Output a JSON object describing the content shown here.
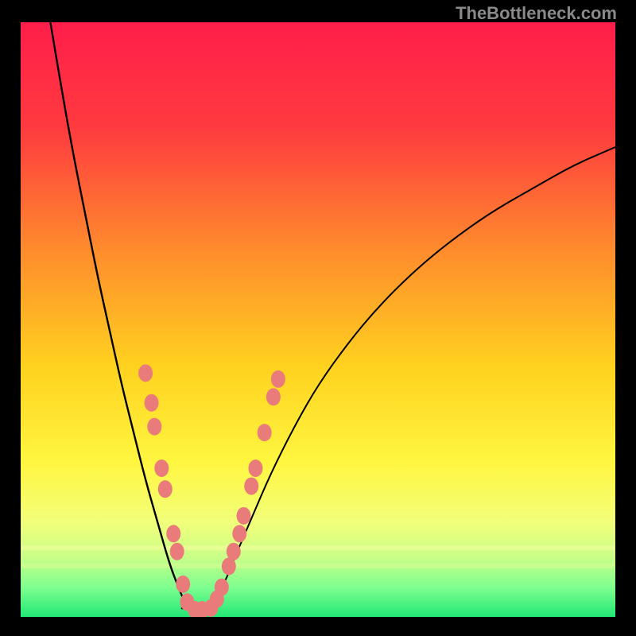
{
  "watermark": "TheBottleneck.com",
  "chart_data": {
    "type": "line",
    "title": "",
    "xlabel": "",
    "ylabel": "",
    "xlim": [
      0,
      100
    ],
    "ylim": [
      0,
      100
    ],
    "series": [
      {
        "name": "left-curve",
        "x": [
          5,
          7,
          9,
          11,
          13,
          15,
          17,
          19,
          21,
          23,
          25,
          26.5,
          28
        ],
        "y": [
          100,
          88,
          77,
          67,
          57,
          48,
          39,
          31,
          23,
          16,
          9,
          5,
          1.5
        ]
      },
      {
        "name": "right-curve",
        "x": [
          32,
          34,
          36,
          39,
          42,
          46,
          50,
          55,
          60,
          66,
          72,
          79,
          86,
          93,
          100
        ],
        "y": [
          1.5,
          5,
          10,
          17,
          24,
          32,
          39,
          46,
          52,
          58,
          63,
          68,
          72,
          76,
          79
        ]
      },
      {
        "name": "valley-floor",
        "x": [
          27,
          28.5,
          30,
          31.5,
          33
        ],
        "y": [
          1.5,
          1.2,
          1.2,
          1.2,
          1.5
        ]
      }
    ],
    "markers": {
      "name": "salmon-dots",
      "points": [
        {
          "x": 21.0,
          "y": 41.0
        },
        {
          "x": 22.0,
          "y": 36.0
        },
        {
          "x": 22.5,
          "y": 32.0
        },
        {
          "x": 23.7,
          "y": 25.0
        },
        {
          "x": 24.3,
          "y": 21.5
        },
        {
          "x": 25.7,
          "y": 14.0
        },
        {
          "x": 26.3,
          "y": 11.0
        },
        {
          "x": 27.3,
          "y": 5.5
        },
        {
          "x": 28.0,
          "y": 2.5
        },
        {
          "x": 29.3,
          "y": 1.2
        },
        {
          "x": 30.5,
          "y": 1.2
        },
        {
          "x": 32.0,
          "y": 1.5
        },
        {
          "x": 33.0,
          "y": 3.0
        },
        {
          "x": 33.8,
          "y": 5.0
        },
        {
          "x": 35.0,
          "y": 8.5
        },
        {
          "x": 35.8,
          "y": 11.0
        },
        {
          "x": 36.8,
          "y": 14.0
        },
        {
          "x": 37.5,
          "y": 17.0
        },
        {
          "x": 38.8,
          "y": 22.0
        },
        {
          "x": 39.5,
          "y": 25.0
        },
        {
          "x": 41.0,
          "y": 31.0
        },
        {
          "x": 42.5,
          "y": 37.0
        },
        {
          "x": 43.3,
          "y": 40.0
        }
      ]
    },
    "gradient_stops": [
      {
        "pct": 0,
        "color": "#ff1e4a"
      },
      {
        "pct": 18,
        "color": "#ff3b3f"
      },
      {
        "pct": 38,
        "color": "#ff8a2d"
      },
      {
        "pct": 58,
        "color": "#ffd21f"
      },
      {
        "pct": 74,
        "color": "#fff640"
      },
      {
        "pct": 84,
        "color": "#f2ff7a"
      },
      {
        "pct": 90,
        "color": "#c9ff88"
      },
      {
        "pct": 95,
        "color": "#7eff8f"
      },
      {
        "pct": 100,
        "color": "#22e876"
      }
    ],
    "colors": {
      "curve": "#000000",
      "marker": "#e97c7a",
      "band_top": "#f6ffa0",
      "band_mid": "#d8ff94"
    }
  }
}
